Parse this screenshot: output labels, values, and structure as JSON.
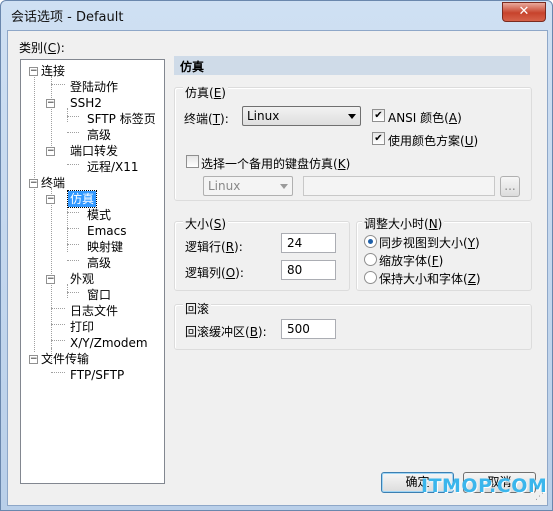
{
  "window": {
    "title": "会话选项 - Default",
    "close": "✕"
  },
  "category": {
    "label_pre": "类别(",
    "label_key": "C",
    "label_post": "):"
  },
  "tree": {
    "connection": "连接",
    "login_actions": "登陆动作",
    "ssh2": "SSH2",
    "sftp_tab": "SFTP 标签页",
    "ssh2_advanced": "高级",
    "port_forwarding": "端口转发",
    "remote_x11": "远程/X11",
    "terminal": "终端",
    "emulation": "仿真",
    "modes": "模式",
    "emacs": "Emacs",
    "mapped_keys": "映射键",
    "emu_advanced": "高级",
    "appearance": "外观",
    "window": "窗口",
    "log_file": "日志文件",
    "printing": "打印",
    "xyzmodem": "X/Y/Zmodem",
    "file_transfer": "文件传输",
    "ftp_sftp": "FTP/SFTP"
  },
  "panel": {
    "header": "仿真"
  },
  "emulation_group": {
    "title_pre": "仿真(",
    "title_key": "E",
    "title_post": ")",
    "terminal_label_pre": "终端(",
    "terminal_label_key": "T",
    "terminal_label_post": "):",
    "terminal_value": "Linux",
    "ansi_color_pre": "ANSI 颜色(",
    "ansi_color_key": "A",
    "ansi_color_post": ")",
    "ansi_color_checked": true,
    "color_scheme_pre": "使用颜色方案(",
    "color_scheme_key": "U",
    "color_scheme_post": ")",
    "color_scheme_checked": true,
    "alt_keyboard_pre": "选择一个备用的键盘仿真(",
    "alt_keyboard_key": "K",
    "alt_keyboard_post": ")",
    "alt_keyboard_checked": false,
    "alt_keyboard_value": "Linux",
    "browse_label": "..."
  },
  "size_group": {
    "title_pre": "大小(",
    "title_key": "S",
    "title_post": ")",
    "rows_pre": "逻辑行(",
    "rows_key": "R",
    "rows_post": "):",
    "rows_value": "24",
    "cols_pre": "逻辑列(",
    "cols_key": "O",
    "cols_post": "):",
    "cols_value": "80"
  },
  "resize_group": {
    "title_pre": "调整大小时(",
    "title_key": "N",
    "title_post": ")",
    "sync_view_pre": "同步视图到大小(",
    "sync_view_key": "Y",
    "sync_view_post": ")",
    "scale_font_pre": "缩放字体(",
    "scale_font_key": "F",
    "scale_font_post": ")",
    "keep_size_pre": "保持大小和字体(",
    "keep_size_key": "Z",
    "keep_size_post": ")",
    "selected": "sync_view"
  },
  "scroll_group": {
    "title": "回滚",
    "buffer_pre": "回滚缓冲区(",
    "buffer_key": "B",
    "buffer_post": "):",
    "buffer_value": "500"
  },
  "buttons": {
    "ok": "确定",
    "cancel": "取消"
  },
  "watermark": "ITMOP.COM"
}
